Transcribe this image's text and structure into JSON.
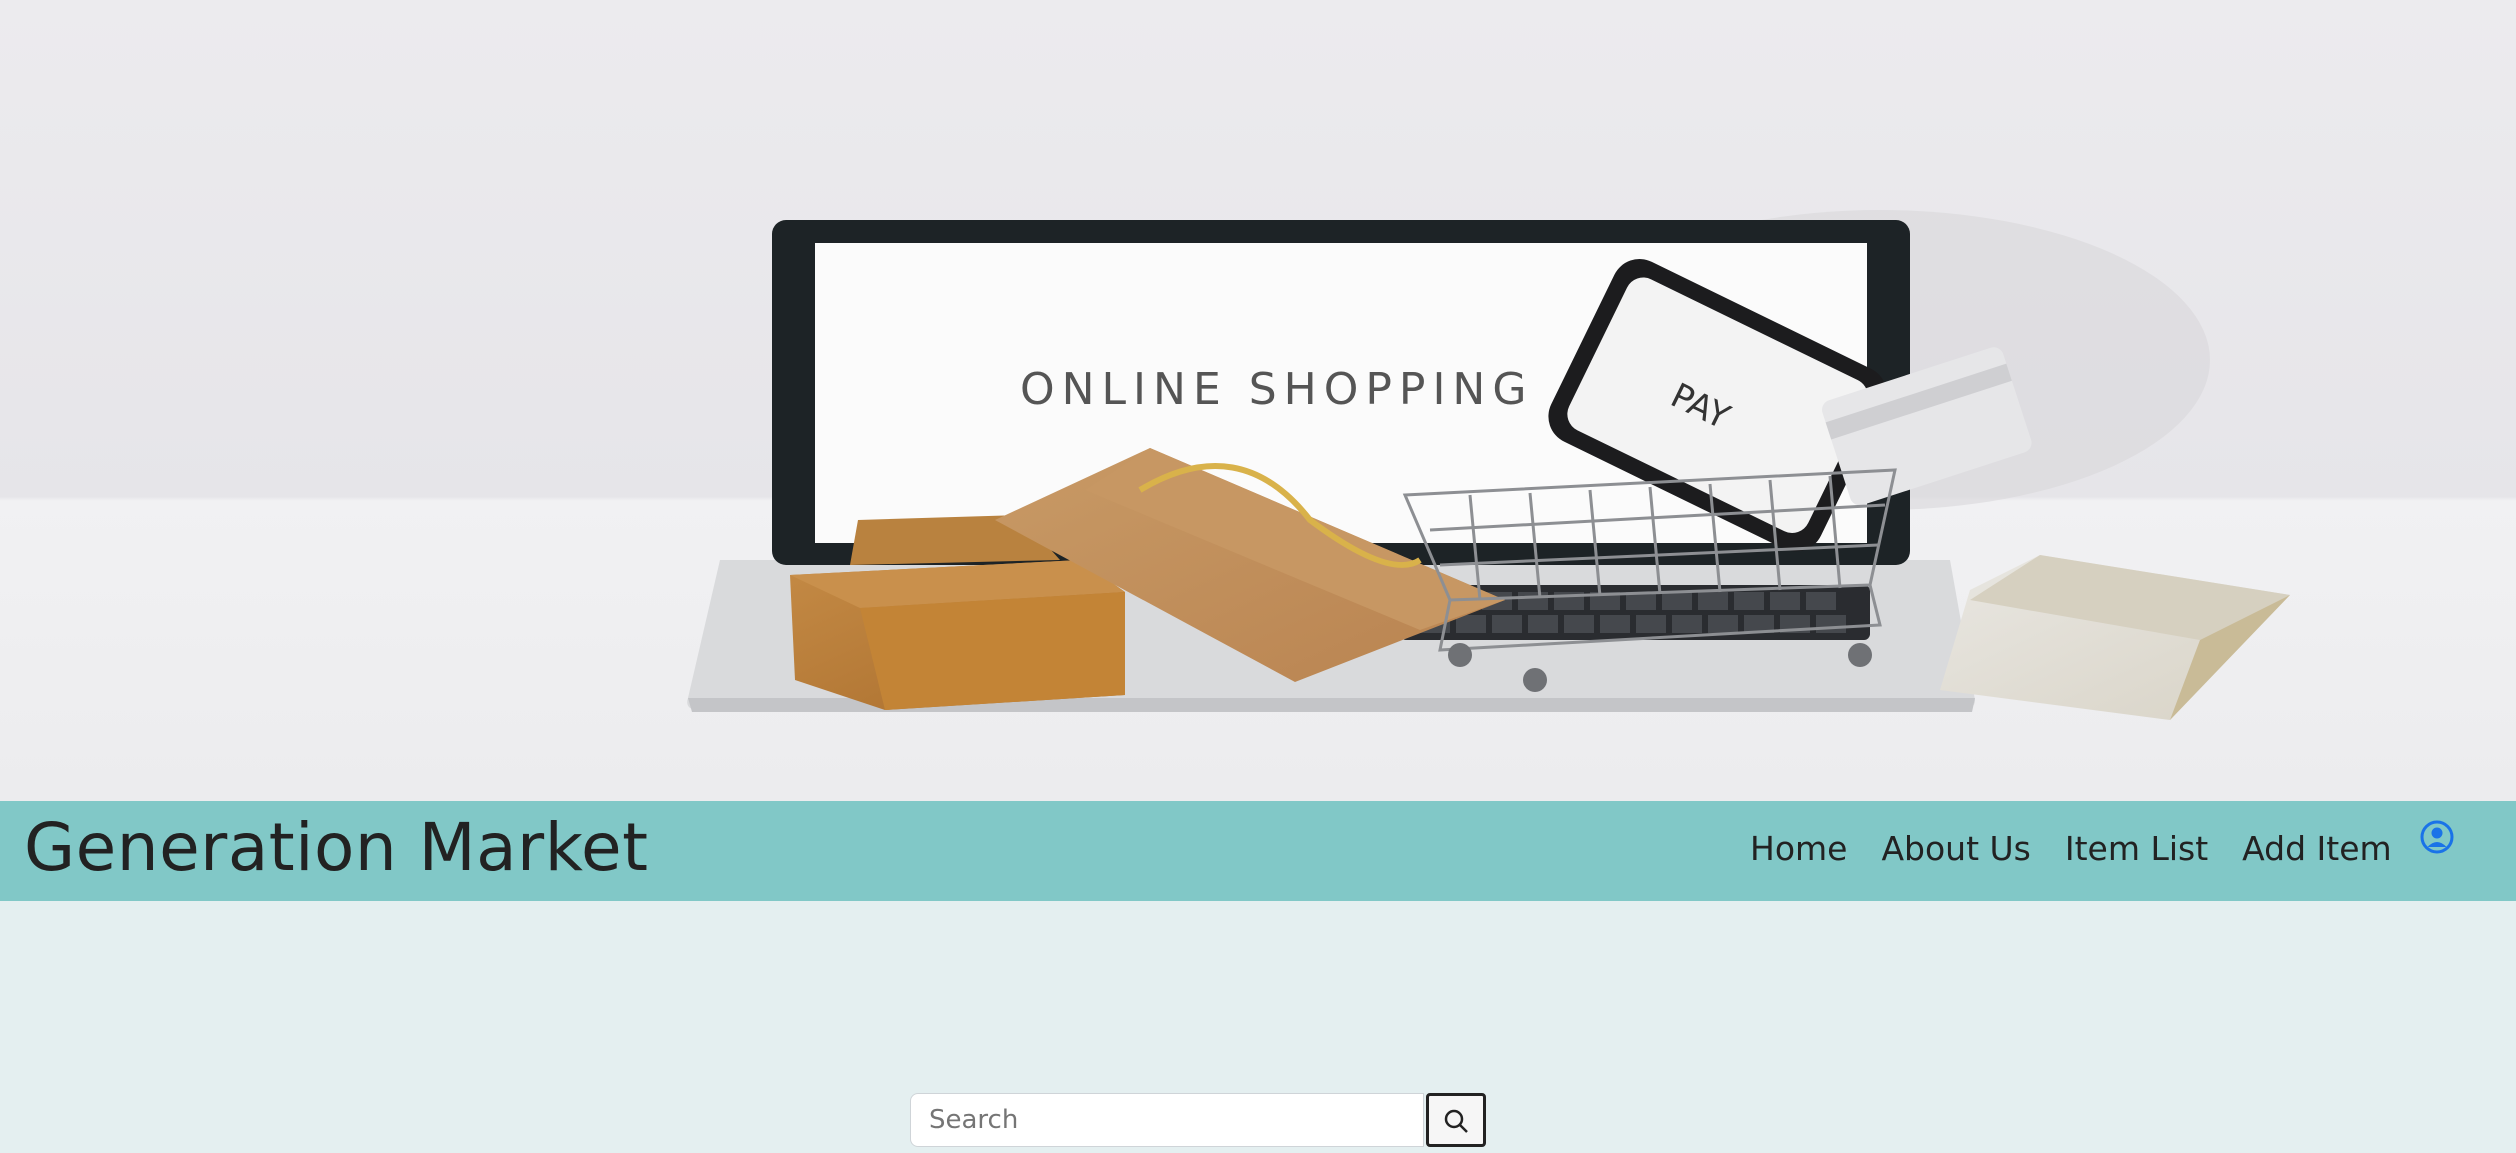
{
  "hero": {
    "screen_text": "ONLINE SHOPPING",
    "phone_text": "PAY"
  },
  "navbar": {
    "brand": "Generation Market",
    "links": [
      {
        "label": "Home"
      },
      {
        "label": "About Us"
      },
      {
        "label": "Item List"
      },
      {
        "label": "Add Item"
      }
    ],
    "user_icon": "user-circle-icon"
  },
  "search": {
    "placeholder": "Search",
    "button_icon": "search-icon"
  },
  "colors": {
    "navbar_bg": "#81c8c7",
    "page_bg": "#e4eff0",
    "user_icon": "#1a73e8"
  }
}
